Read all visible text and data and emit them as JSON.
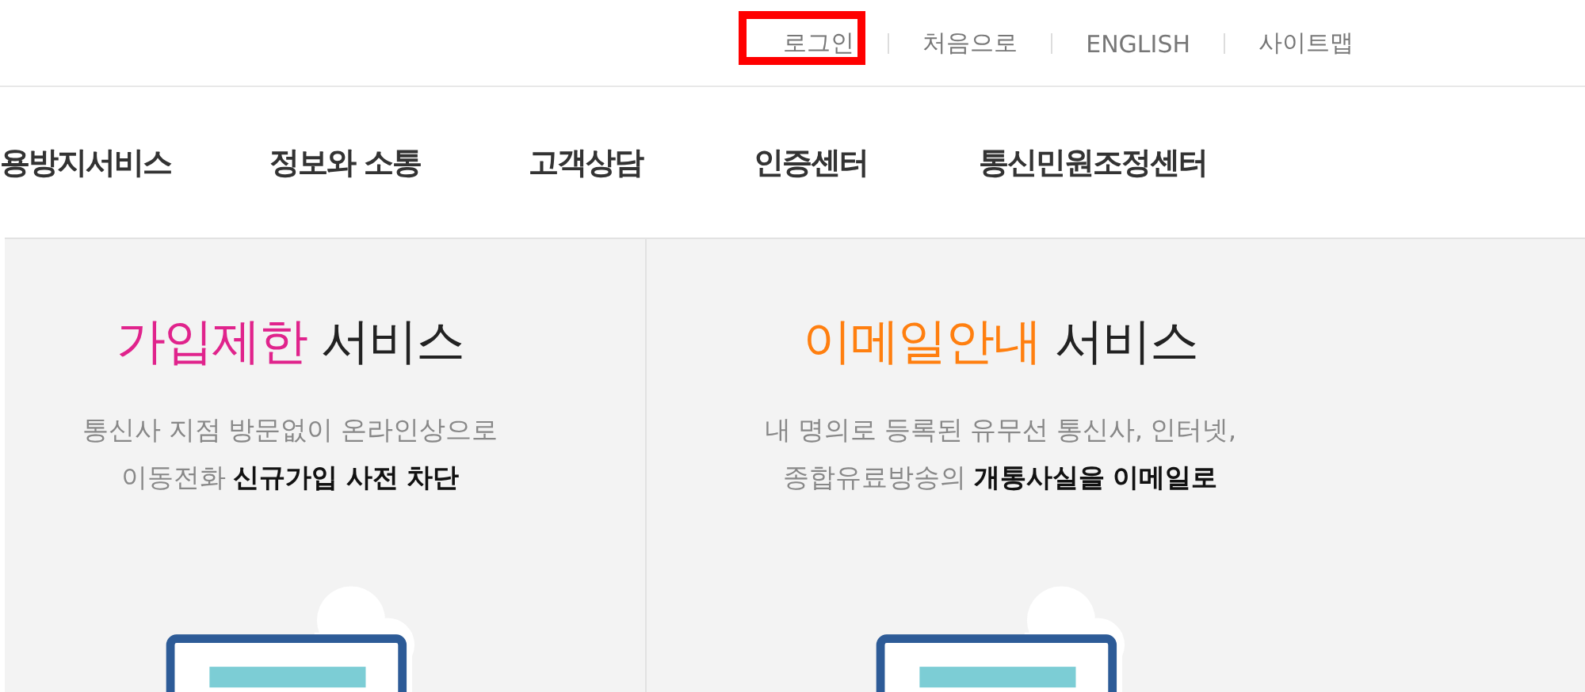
{
  "util_links": [
    {
      "label": "로그인",
      "highlighted": true
    },
    {
      "label": "처음으로",
      "highlighted": false
    },
    {
      "label": "ENGLISH",
      "highlighted": false
    },
    {
      "label": "사이트맵",
      "highlighted": false
    }
  ],
  "nav": [
    "용방지서비스",
    "정보와 소통",
    "고객상담",
    "인증센터",
    "통신민원조정센터"
  ],
  "cards": [
    {
      "accent": "가입제한",
      "rest": "서비스",
      "color": "#e0238c",
      "lines": [
        "통신사 지점 방문없이 온라인상으로",
        "이동전화 **신규가입 사전 차단**"
      ]
    },
    {
      "accent": "이메일안내",
      "rest": "서비스",
      "color": "#ff7f0f",
      "lines": [
        "내 명의로 등록된 유무선 통신사, 인터넷,",
        "종합유료방송의 **개통사실을 이메일로**"
      ]
    }
  ]
}
